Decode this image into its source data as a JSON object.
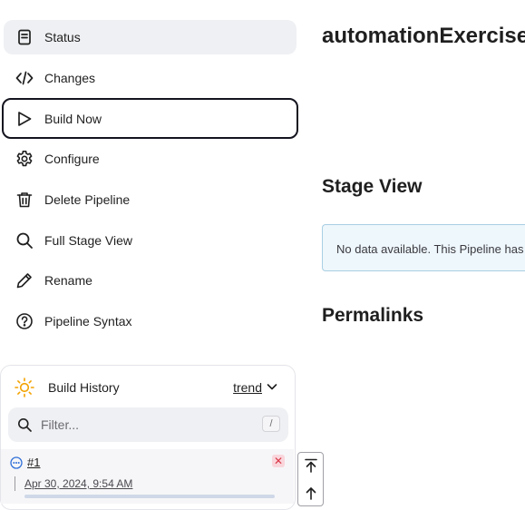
{
  "sidebar": {
    "items": [
      {
        "label": "Status",
        "icon": "document-icon"
      },
      {
        "label": "Changes",
        "icon": "code-icon"
      },
      {
        "label": "Build Now",
        "icon": "play-icon"
      },
      {
        "label": "Configure",
        "icon": "gear-icon"
      },
      {
        "label": "Delete Pipeline",
        "icon": "trash-icon"
      },
      {
        "label": "Full Stage View",
        "icon": "search-icon"
      },
      {
        "label": "Rename",
        "icon": "pencil-icon"
      },
      {
        "label": "Pipeline Syntax",
        "icon": "help-icon"
      }
    ]
  },
  "build_history": {
    "title": "Build History",
    "trend_label": "trend",
    "filter_placeholder": "Filter...",
    "filter_shortcut": "/",
    "builds": [
      {
        "number": "#1",
        "date": "Apr 30, 2024, 9:54 AM",
        "status_icon": "in-progress-icon"
      }
    ]
  },
  "main": {
    "title": "automationExercise",
    "stage_view_heading": "Stage View",
    "stage_view_notice": "No data available. This Pipeline has not yet run.",
    "permalinks_heading": "Permalinks"
  },
  "colors": {
    "active_item_bg": "#eff0f3",
    "focus_border": "#14141f",
    "notice_bg": "#eef7fc",
    "notice_border": "#a9cfe3",
    "cancel_red": "#d93747",
    "sun_yellow": "#f2a200"
  }
}
